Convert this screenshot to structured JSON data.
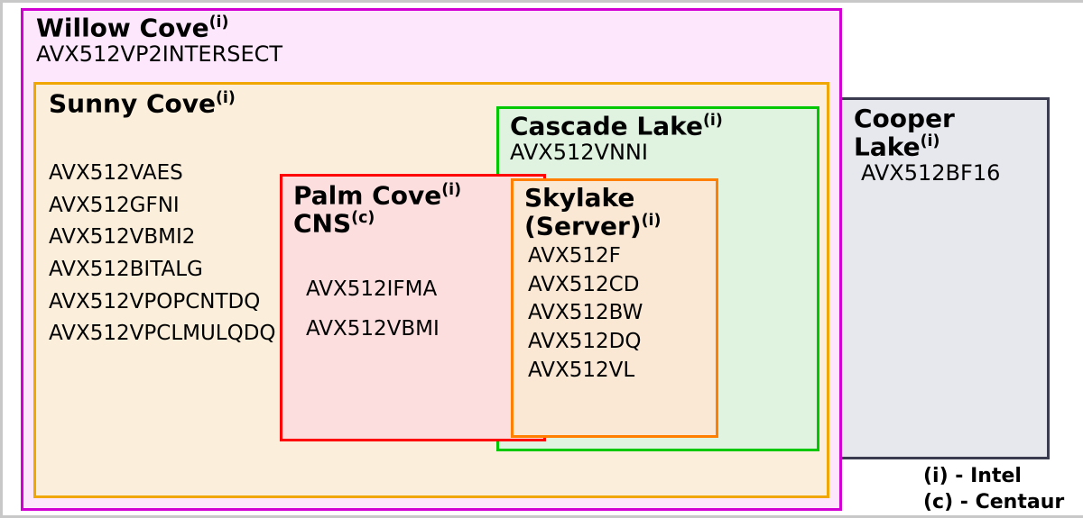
{
  "willow": {
    "title": "Willow Cove",
    "sup": "(i)",
    "features": [
      "AVX512VP2INTERSECT"
    ]
  },
  "sunny": {
    "title": "Sunny Cove",
    "sup": "(i)",
    "features": [
      "AVX512VAES",
      "AVX512GFNI",
      "AVX512VBMI2",
      "AVX512BITALG",
      "AVX512VPOPCNTDQ",
      "AVX512VPCLMULQDQ"
    ]
  },
  "palm": {
    "title1": "Palm Cove",
    "sup1": "(i)",
    "title2": "CNS",
    "sup2": "(c)",
    "features": [
      "AVX512IFMA",
      "AVX512VBMI"
    ]
  },
  "cascade": {
    "title": "Cascade Lake",
    "sup": "(i)",
    "features": [
      "AVX512VNNI"
    ]
  },
  "skylake": {
    "title1": "Skylake",
    "title2": "(Server)",
    "sup": "(i)",
    "features": [
      "AVX512F",
      "AVX512CD",
      "AVX512BW",
      "AVX512DQ",
      "AVX512VL"
    ]
  },
  "cooper": {
    "title": "Cooper Lake",
    "sup": "(i)",
    "features": [
      "AVX512BF16"
    ]
  },
  "legend": {
    "i": "(i) - Intel",
    "c": "(c) - Centaur"
  }
}
